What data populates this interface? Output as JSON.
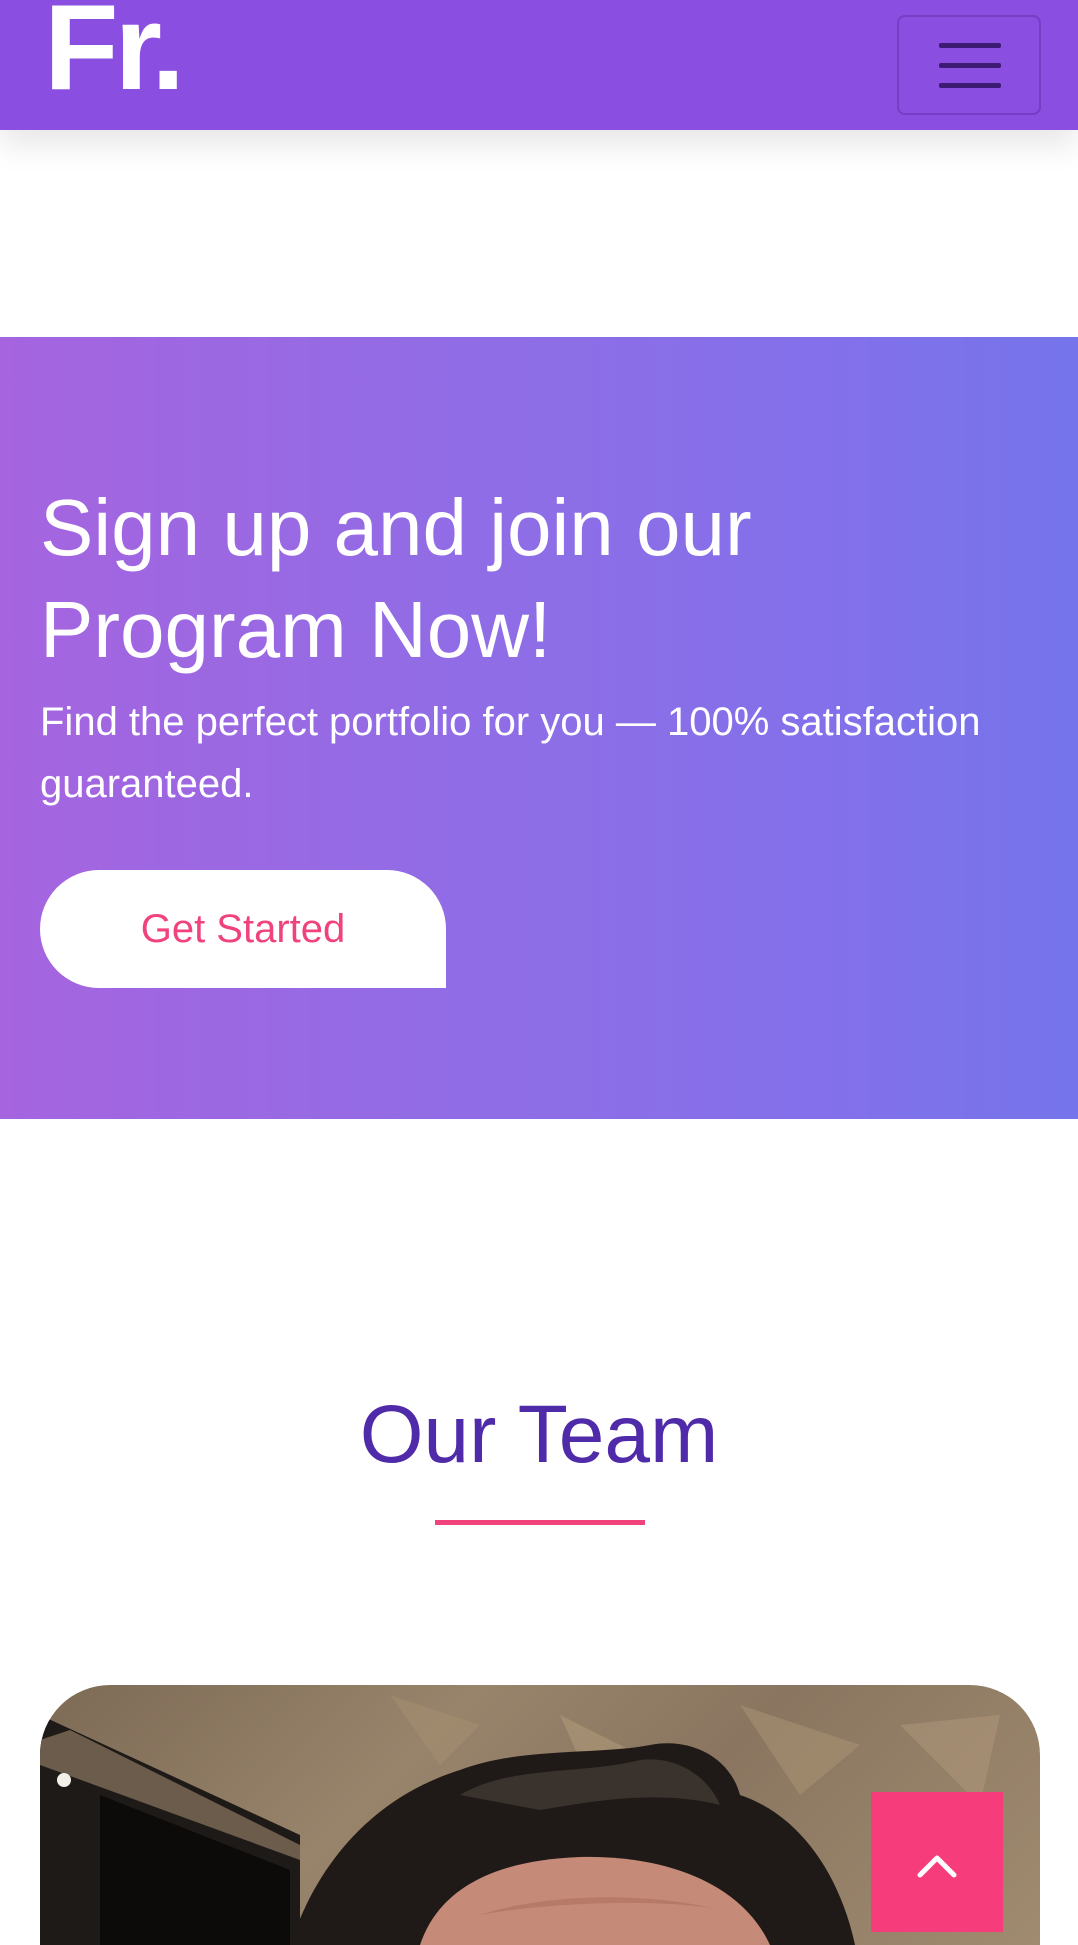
{
  "header": {
    "brand": "Fr.",
    "menu_icon": "hamburger-menu-icon"
  },
  "cta": {
    "title": "Sign up and join our Program Now!",
    "subtitle": "Find the perfect portfolio for you — 100% satisfaction guaranteed.",
    "button_label": "Get Started"
  },
  "team": {
    "title": "Our Team"
  },
  "back_to_top": {
    "icon": "chevron-up-icon"
  },
  "colors": {
    "header_bg": "#8a4fe0",
    "accent_pink": "#f0437c",
    "team_title": "#4f2aa9",
    "cta_gradient_start": "#a664df",
    "cta_gradient_end": "#7574ea"
  }
}
